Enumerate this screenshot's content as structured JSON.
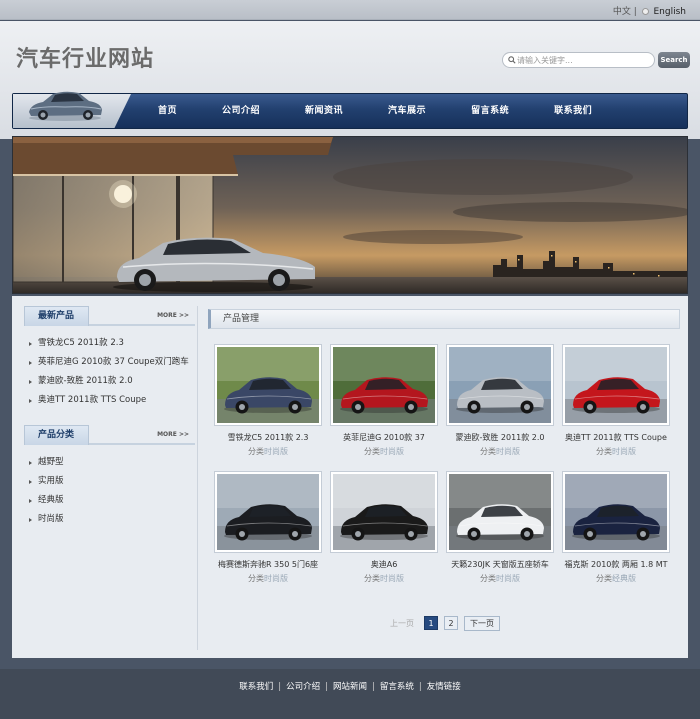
{
  "lang": {
    "chinese": "中文",
    "separator": "|",
    "english": "English"
  },
  "site": {
    "title": "汽车行业网站"
  },
  "search": {
    "placeholder": "请输入关键字...",
    "button": "Search"
  },
  "nav": {
    "items": [
      "首页",
      "公司介绍",
      "新闻资讯",
      "汽车展示",
      "留言系统",
      "联系我们"
    ]
  },
  "sidebar": {
    "latest": {
      "title": "最新产品",
      "more": "MORE >>",
      "items": [
        "雪铁龙C5 2011款 2.3",
        "英菲尼迪G 2010款 37 Coupe双门跑车",
        "蒙迪欧-致胜 2011款 2.0",
        "奥迪TT 2011款 TTS Coupe"
      ]
    },
    "categories": {
      "title": "产品分类",
      "more": "MORE >>",
      "items": [
        "越野型",
        "实用版",
        "经典版",
        "时尚版"
      ]
    }
  },
  "main": {
    "title": "产品管理",
    "cat_label": "分类",
    "products": [
      {
        "name": "雪铁龙C5 2011款 2.3",
        "category": "时尚版",
        "color": "#3a4766",
        "bg": "#6f8a4a"
      },
      {
        "name": "英菲尼迪G 2010款 37",
        "category": "时尚版",
        "color": "#b4161e",
        "bg": "#4f6d3a"
      },
      {
        "name": "蒙迪欧-致胜 2011款 2.0",
        "category": "时尚版",
        "color": "#b9bec4",
        "bg": "#8aa0b5"
      },
      {
        "name": "奥迪TT 2011款 TTS Coupe",
        "category": "时尚版",
        "color": "#c4161c",
        "bg": "#b8c4cf"
      },
      {
        "name": "梅赛德斯奔驰R 350 5门6座",
        "category": "时尚版",
        "color": "#1b1d21",
        "bg": "#9eaab6"
      },
      {
        "name": "奥迪A6",
        "category": "时尚版",
        "color": "#1a1a1a",
        "bg": "#cfd3d8"
      },
      {
        "name": "天籁230JK 天窗版五座轿车",
        "category": "时尚版",
        "color": "#eef0f2",
        "bg": "#6b6f70"
      },
      {
        "name": "福克斯 2010款 两厢 1.8 MT",
        "category": "经典版",
        "color": "#1a2340",
        "bg": "#8c97a8"
      }
    ],
    "pager": {
      "prev": "上一页",
      "pages": [
        "1",
        "2"
      ],
      "active": "1",
      "next": "下一页"
    }
  },
  "footer": {
    "links": [
      "联系我们",
      "公司介绍",
      "网站新闻",
      "留言系统",
      "友情链接"
    ]
  },
  "colors": {
    "nav": "#22406f",
    "accent": "#264a80",
    "footer": "#414a57"
  }
}
